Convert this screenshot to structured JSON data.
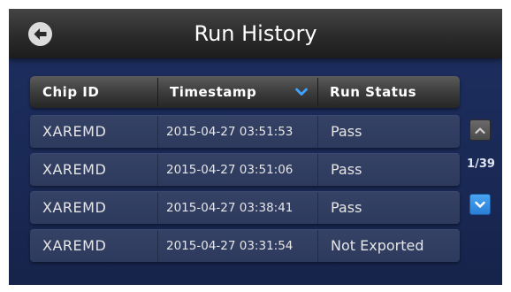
{
  "header": {
    "title": "Run History",
    "back_icon": "back-arrow-icon"
  },
  "table": {
    "columns": [
      "Chip ID",
      "Timestamp",
      "Run Status"
    ],
    "sort_icon": "chevron-down-icon",
    "rows": [
      {
        "chip_id": "XAREMD",
        "timestamp": "2015-04-27 03:51:53",
        "status": "Pass"
      },
      {
        "chip_id": "XAREMD",
        "timestamp": "2015-04-27 03:51:06",
        "status": "Pass"
      },
      {
        "chip_id": "XAREMD",
        "timestamp": "2015-04-27 03:38:41",
        "status": "Pass"
      },
      {
        "chip_id": "XAREMD",
        "timestamp": "2015-04-27 03:31:54",
        "status": "Not Exported"
      }
    ]
  },
  "pager": {
    "indicator": "1/39",
    "up_icon": "chevron-up-icon",
    "down_icon": "chevron-down-icon"
  },
  "colors": {
    "background": "#1a2955",
    "accent": "#2e8ce6"
  }
}
